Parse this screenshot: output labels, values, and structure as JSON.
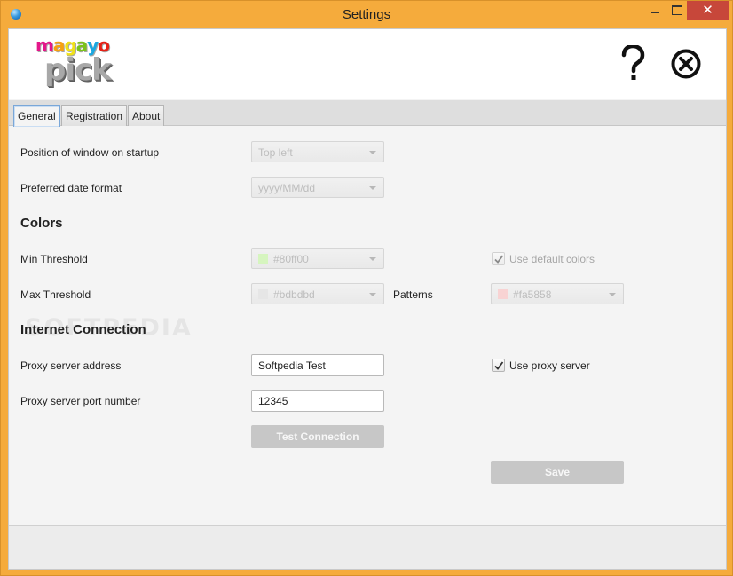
{
  "window": {
    "title": "Settings",
    "close_glyph": "✕"
  },
  "logo": {
    "line1_letters": [
      "m",
      "a",
      "g",
      "a",
      "y",
      "o"
    ],
    "line1_colors": [
      "#e4178a",
      "#f7a20f",
      "#f0e11a",
      "#7ac21c",
      "#1aa7e0",
      "#e62117"
    ],
    "line2": "pick"
  },
  "header": {
    "help_icon": "question-mark-icon",
    "close_icon": "circle-x-icon"
  },
  "tabs": [
    {
      "label": "General",
      "active": true
    },
    {
      "label": "Registration",
      "active": false
    },
    {
      "label": "About",
      "active": false
    }
  ],
  "general": {
    "position_label": "Position of window on startup",
    "position_value": "Top left",
    "date_format_label": "Preferred date format",
    "date_format_value": "yyyy/MM/dd",
    "colors_heading": "Colors",
    "min_threshold_label": "Min Threshold",
    "min_threshold_value": "#80ff00",
    "min_threshold_color": "#d6f5bf",
    "use_default_colors_label": "Use default colors",
    "use_default_colors_checked": true,
    "max_threshold_label": "Max Threshold",
    "max_threshold_value": "#bdbdbd",
    "max_threshold_color": "#e6e6e6",
    "patterns_label": "Patterns",
    "patterns_value": "#fa5858",
    "patterns_color": "#f8d3d3",
    "internet_heading": "Internet Connection",
    "proxy_address_label": "Proxy server address",
    "proxy_address_value": "Softpedia Test",
    "use_proxy_label": "Use proxy server",
    "use_proxy_checked": true,
    "proxy_port_label": "Proxy server port number",
    "proxy_port_value": "12345",
    "test_connection_label": "Test Connection",
    "save_label": "Save"
  },
  "watermark": "SOFTPEDIA"
}
